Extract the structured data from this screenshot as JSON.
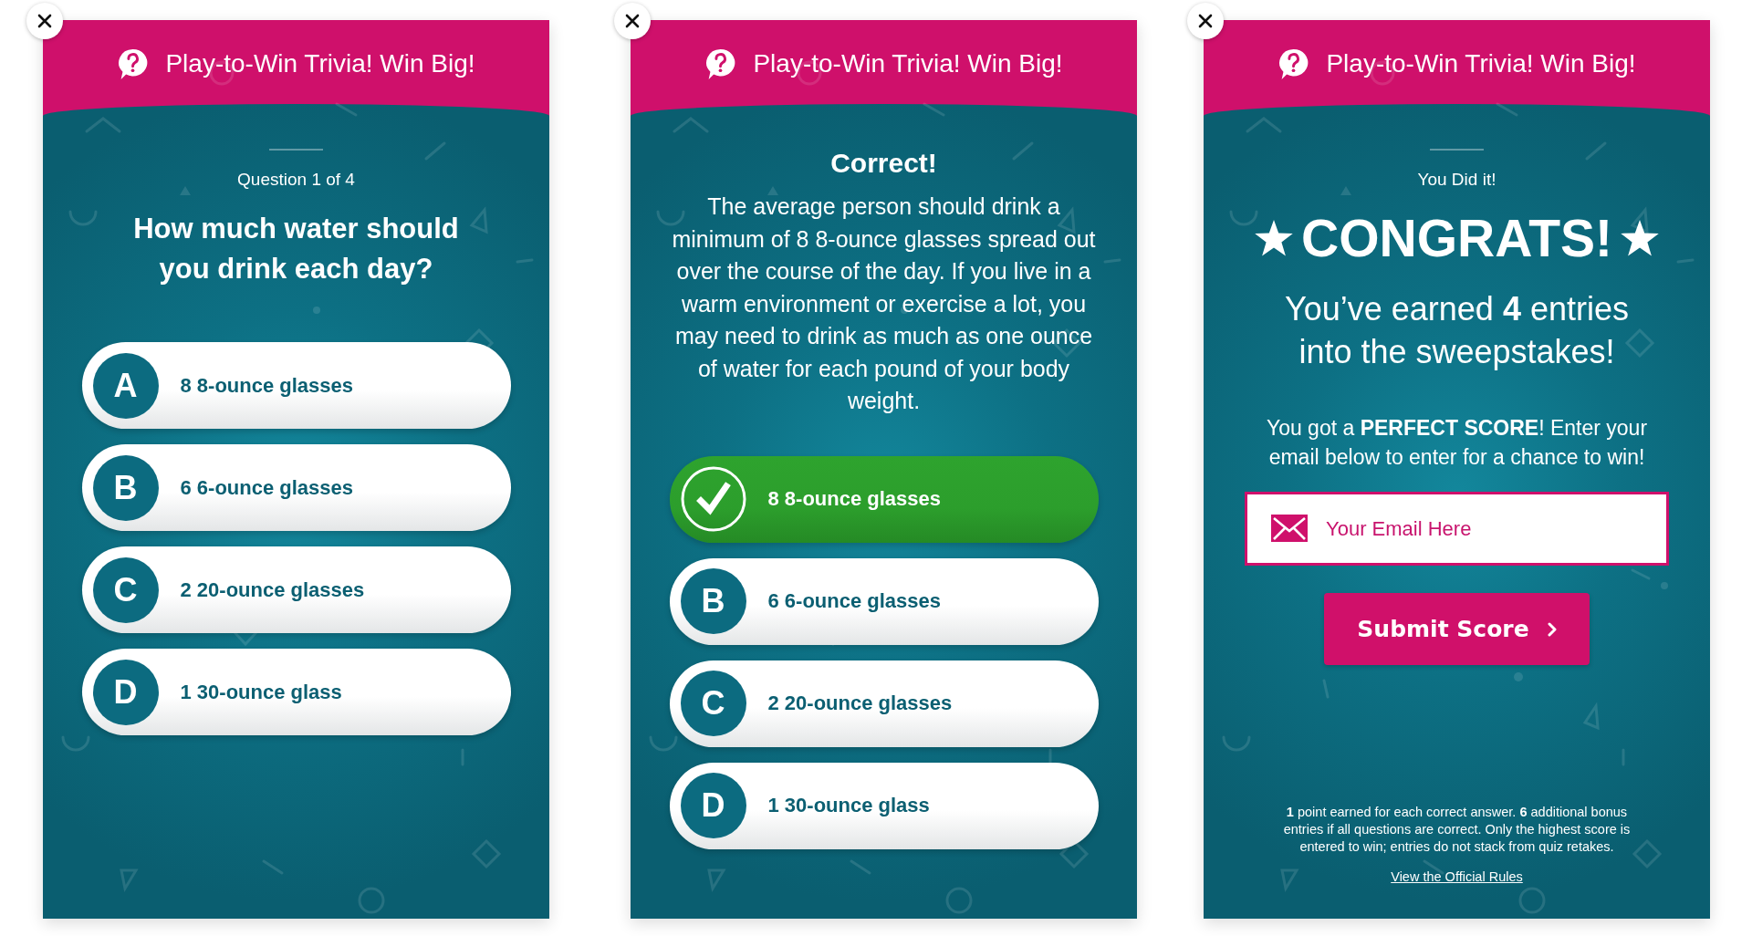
{
  "screens": [
    {
      "kind": "question",
      "header": {
        "title": "Play-to-Win Trivia! Win Big!"
      },
      "progress": "Question 1 of 4",
      "question": "How much water should you drink each day?",
      "options": [
        {
          "letter": "A",
          "text": "8 8-ounce glasses",
          "correct": false
        },
        {
          "letter": "B",
          "text": "6 6-ounce glasses",
          "correct": false
        },
        {
          "letter": "C",
          "text": "2 20-ounce glasses",
          "correct": false
        },
        {
          "letter": "D",
          "text": "1 30-ounce glass",
          "correct": false
        }
      ]
    },
    {
      "kind": "answer",
      "header": {
        "title": "Play-to-Win Trivia! Win Big!"
      },
      "result": "Correct!",
      "explanation": "The average person should drink a minimum of 8 8-ounce glasses spread out over the course of the day. If you live in a warm environment or exercise a lot, you may need to drink as much as one ounce of water for each pound of your body weight.",
      "options": [
        {
          "text": "8 8-ounce glasses",
          "correct": true
        },
        {
          "letter": "B",
          "text": "6 6-ounce glasses",
          "correct": false
        },
        {
          "letter": "C",
          "text": "2 20-ounce glasses",
          "correct": false
        },
        {
          "letter": "D",
          "text": "1 30-ounce glass",
          "correct": false
        }
      ]
    },
    {
      "kind": "results",
      "header": {
        "title": "Play-to-Win Trivia! Win Big!"
      },
      "eyebrow": "You Did it!",
      "headline": "CONGRATS!",
      "entries_message": "You’ve earned **4** entries into the sweepstakes!",
      "score_message": "You got a **PERFECT SCORE**! Enter your email below to enter for a chance to win!",
      "email_field": {
        "placeholder": "Your Email Here"
      },
      "submit_button": {
        "label": "Submit Score"
      },
      "fine_print": "**1** point earned for each correct answer. **6** additional bonus entries if all questions are correct. Only the highest score is entered to win; entries do not stack from quiz retakes.",
      "rules_link": "View the Official Rules"
    }
  ]
}
